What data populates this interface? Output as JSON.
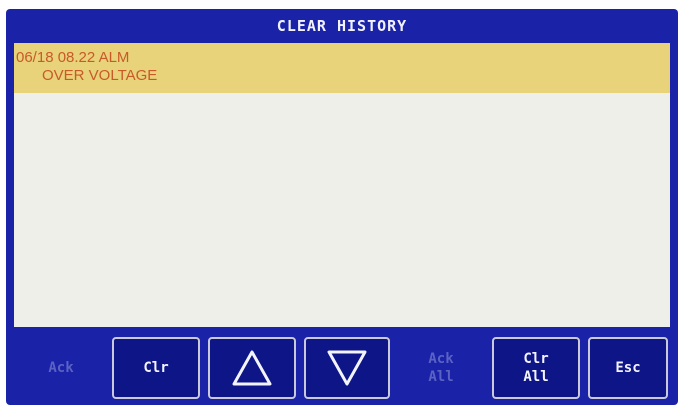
{
  "title": "CLEAR HISTORY",
  "alarms": [
    {
      "line1": "06/18 08.22 ALM",
      "line2": "OVER VOLTAGE"
    }
  ],
  "buttons": {
    "ack": "Ack",
    "clr": "Clr",
    "up_icon": "up-triangle",
    "down_icon": "down-triangle",
    "ack_all": "Ack\nAll",
    "clr_all": "Clr\nAll",
    "esc": "Esc"
  },
  "colors": {
    "background": "#1a23a8",
    "highlight_row": "#e8d27a",
    "alarm_text": "#c85a2a",
    "list_background": "#efefea"
  }
}
